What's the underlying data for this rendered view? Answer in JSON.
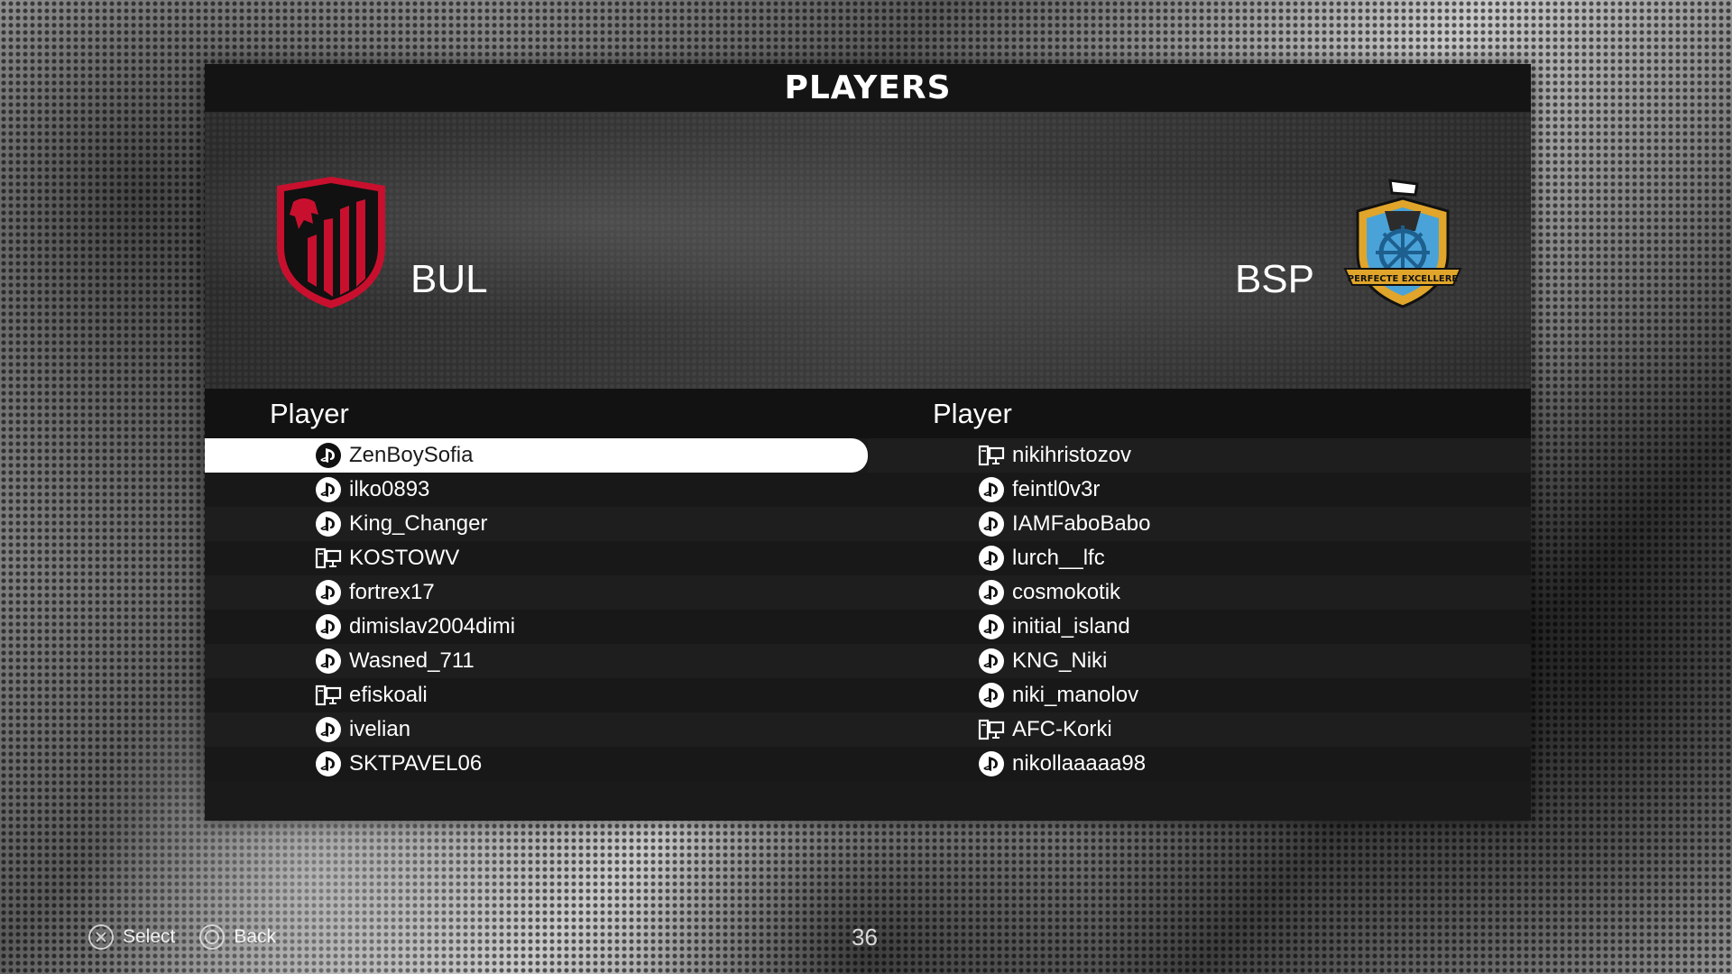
{
  "title": "PLAYERS",
  "home_team": {
    "abbr": "BUL",
    "crest_icon": "lion-shield-crest-icon",
    "colors": [
      "#c8102e",
      "#111111"
    ]
  },
  "away_team": {
    "abbr": "BSP",
    "crest_icon": "ship-wheel-crest-icon",
    "motto": "PERFECTE EXCELLERE",
    "colors": [
      "#e0a52a",
      "#4aa3d8"
    ]
  },
  "header": {
    "left_label": "Player",
    "right_label": "Player"
  },
  "home_players": [
    {
      "name": "ZenBoySofia",
      "platform": "playstation-icon",
      "selected": true
    },
    {
      "name": "ilko0893",
      "platform": "playstation-icon"
    },
    {
      "name": "King_Changer",
      "platform": "playstation-icon"
    },
    {
      "name": "KOSTOWV",
      "platform": "pc-icon"
    },
    {
      "name": "fortrex17",
      "platform": "playstation-icon"
    },
    {
      "name": "dimislav2004dimi",
      "platform": "playstation-icon"
    },
    {
      "name": "Wasned_711",
      "platform": "playstation-icon"
    },
    {
      "name": "efiskoali",
      "platform": "pc-icon"
    },
    {
      "name": "ivelian",
      "platform": "playstation-icon"
    },
    {
      "name": "SKTPAVEL06",
      "platform": "playstation-icon"
    }
  ],
  "away_players": [
    {
      "name": "nikihristozov",
      "platform": "pc-icon"
    },
    {
      "name": "feintl0v3r",
      "platform": "playstation-icon"
    },
    {
      "name": "IAMFaboBabo",
      "platform": "playstation-icon"
    },
    {
      "name": "lurch__lfc",
      "platform": "playstation-icon"
    },
    {
      "name": "cosmokotik",
      "platform": "playstation-icon"
    },
    {
      "name": "initial_island",
      "platform": "playstation-icon"
    },
    {
      "name": "KNG_Niki",
      "platform": "playstation-icon"
    },
    {
      "name": "niki_manolov",
      "platform": "playstation-icon"
    },
    {
      "name": "AFC-Korki",
      "platform": "pc-icon"
    },
    {
      "name": "nikollaaaaa98",
      "platform": "playstation-icon"
    }
  ],
  "footer": {
    "select_label": "Select",
    "back_label": "Back",
    "counter": "36"
  }
}
